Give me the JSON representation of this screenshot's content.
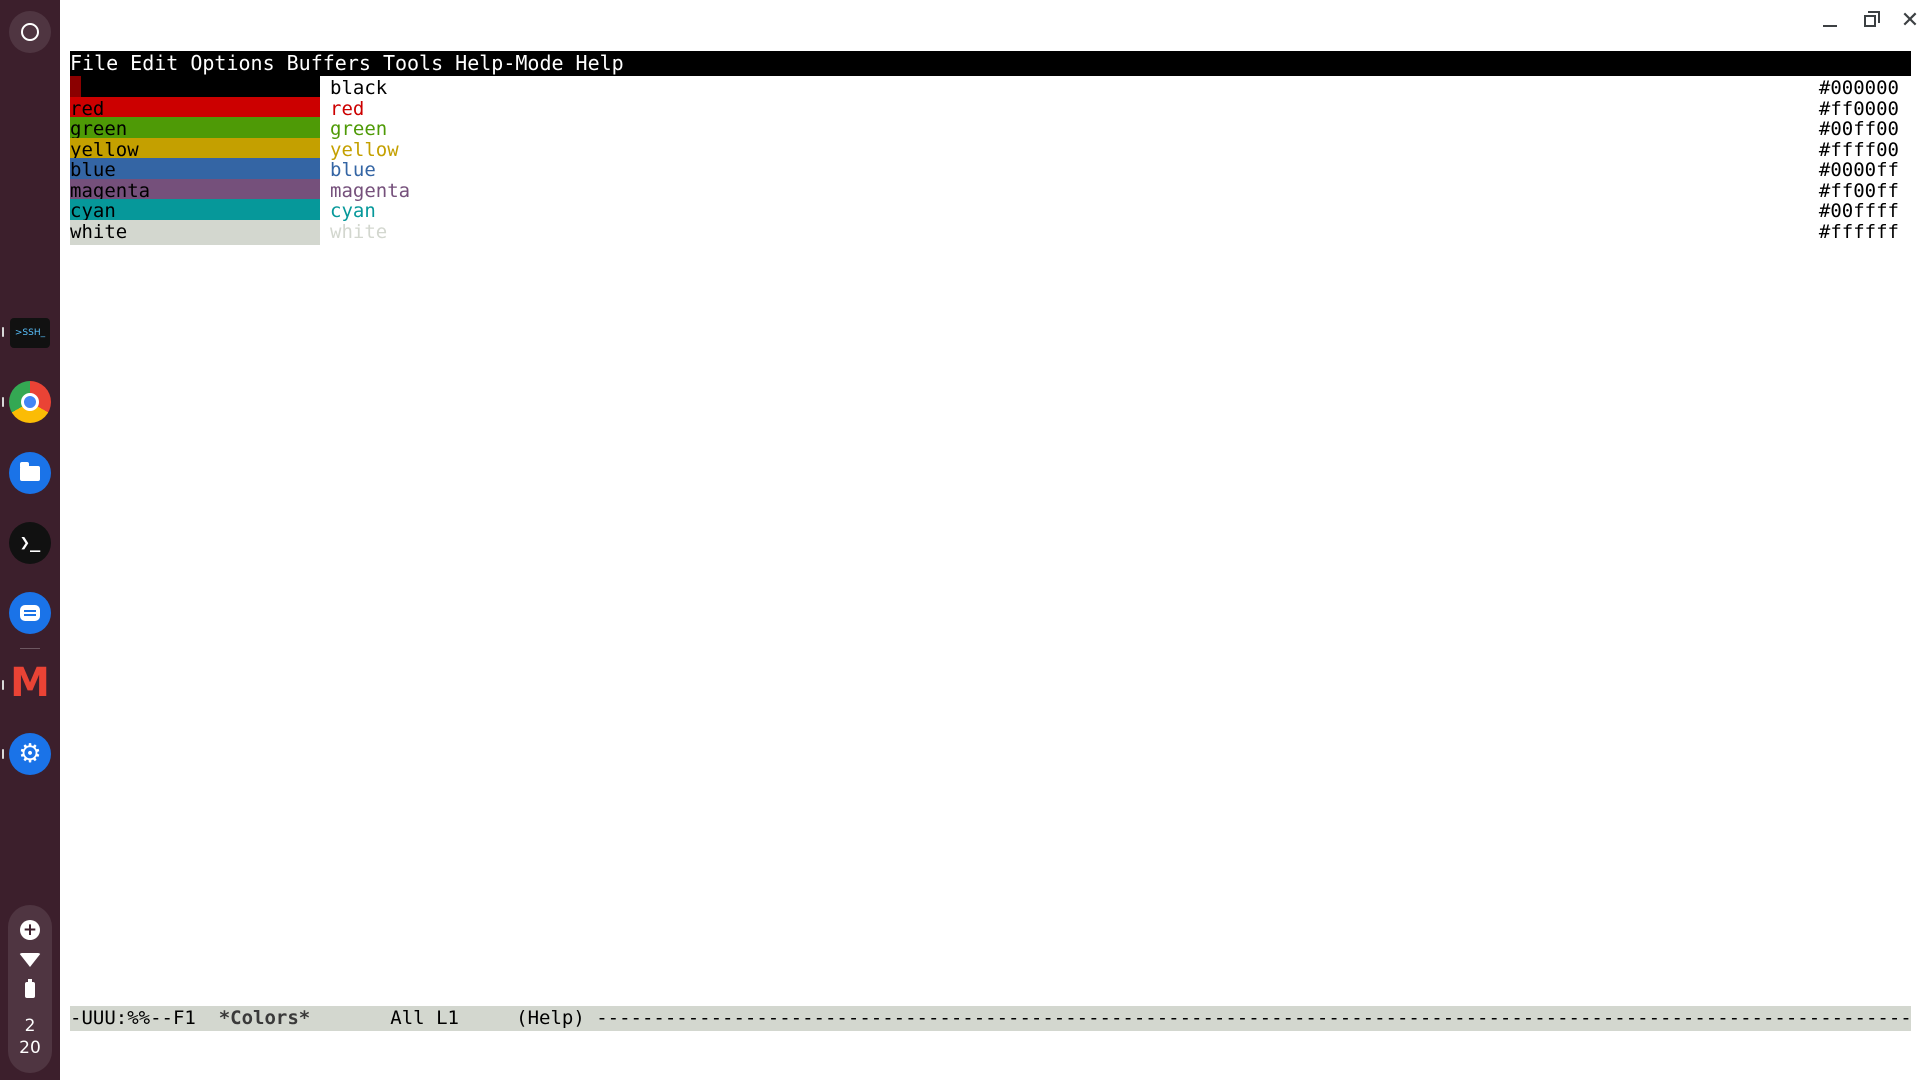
{
  "shelf": {
    "ssh_label": ">SSH_",
    "terminal_glyph": "❯_",
    "settings_glyph": "⚙",
    "clock": {
      "hour": "2",
      "minute": "20"
    }
  },
  "menubar": {
    "items": [
      "File",
      "Edit",
      "Options",
      "Buffers",
      "Tools",
      "Help-Mode",
      "Help"
    ]
  },
  "colors": [
    {
      "swatch_label": "",
      "name": "black",
      "hex": "#000000",
      "swatch_color": "#000000",
      "text_color": "#000000"
    },
    {
      "swatch_label": "red",
      "name": "red",
      "hex": "#ff0000",
      "swatch_color": "#cc0000",
      "text_color": "#cc0000"
    },
    {
      "swatch_label": "green",
      "name": "green",
      "hex": "#00ff00",
      "swatch_color": "#4e9a06",
      "text_color": "#4e9a06"
    },
    {
      "swatch_label": "yellow",
      "name": "yellow",
      "hex": "#ffff00",
      "swatch_color": "#c4a000",
      "text_color": "#c4a000"
    },
    {
      "swatch_label": "blue",
      "name": "blue",
      "hex": "#0000ff",
      "swatch_color": "#3465a4",
      "text_color": "#3465a4"
    },
    {
      "swatch_label": "magenta",
      "name": "magenta",
      "hex": "#ff00ff",
      "swatch_color": "#75507b",
      "text_color": "#75507b"
    },
    {
      "swatch_label": "cyan",
      "name": "cyan",
      "hex": "#00ffff",
      "swatch_color": "#06989a",
      "text_color": "#06989a"
    },
    {
      "swatch_label": "white",
      "name": "white",
      "hex": "#ffffff",
      "swatch_color": "#d3d7cf",
      "text_color": "#d3d7cf"
    }
  ],
  "modeline": {
    "status": "-UUU:%%--F1  ",
    "buffer": "*Colors*",
    "position": "       All L1     ",
    "mode": "(Help) ",
    "fill": "-----------------------------------------------------------------------------------------------------------------------------------------------------------------"
  }
}
